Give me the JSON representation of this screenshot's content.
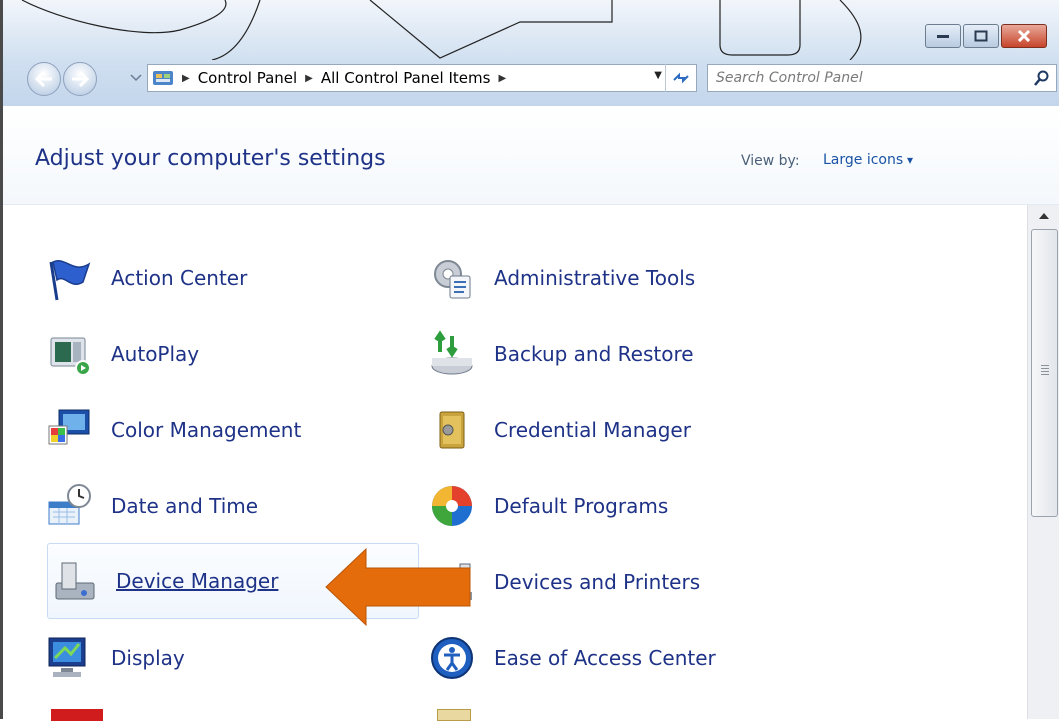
{
  "window": {
    "caption_buttons": [
      "minimize",
      "maximize",
      "close"
    ]
  },
  "navbar": {
    "back_icon": "back-arrow-icon",
    "forward_icon": "forward-arrow-icon",
    "breadcrumbs": [
      "Control Panel",
      "All Control Panel Items"
    ],
    "search_placeholder": "Search Control Panel"
  },
  "header": {
    "title": "Adjust your computer's settings",
    "view_by_label": "View by:",
    "view_by_value": "Large icons"
  },
  "items": [
    {
      "label": "Action Center",
      "icon": "action-center-flag-icon"
    },
    {
      "label": "Administrative Tools",
      "icon": "administrative-tools-icon"
    },
    {
      "label": "AutoPlay",
      "icon": "autoplay-icon"
    },
    {
      "label": "Backup and Restore",
      "icon": "backup-restore-icon"
    },
    {
      "label": "Color Management",
      "icon": "color-management-icon"
    },
    {
      "label": "Credential Manager",
      "icon": "credential-manager-icon"
    },
    {
      "label": "Date and Time",
      "icon": "date-time-icon"
    },
    {
      "label": "Default Programs",
      "icon": "default-programs-icon"
    },
    {
      "label": "Device Manager",
      "icon": "device-manager-icon",
      "highlighted": true
    },
    {
      "label": "Devices and Printers",
      "icon": "devices-printers-icon"
    },
    {
      "label": "Display",
      "icon": "display-icon"
    },
    {
      "label": "Ease of Access Center",
      "icon": "ease-of-access-icon"
    }
  ],
  "annotation": {
    "type": "arrow",
    "color": "#e46c0a",
    "points_to": "Device Manager"
  },
  "colors": {
    "link": "#1e3287",
    "title": "#1e3287",
    "accent": "#1a53a5"
  }
}
